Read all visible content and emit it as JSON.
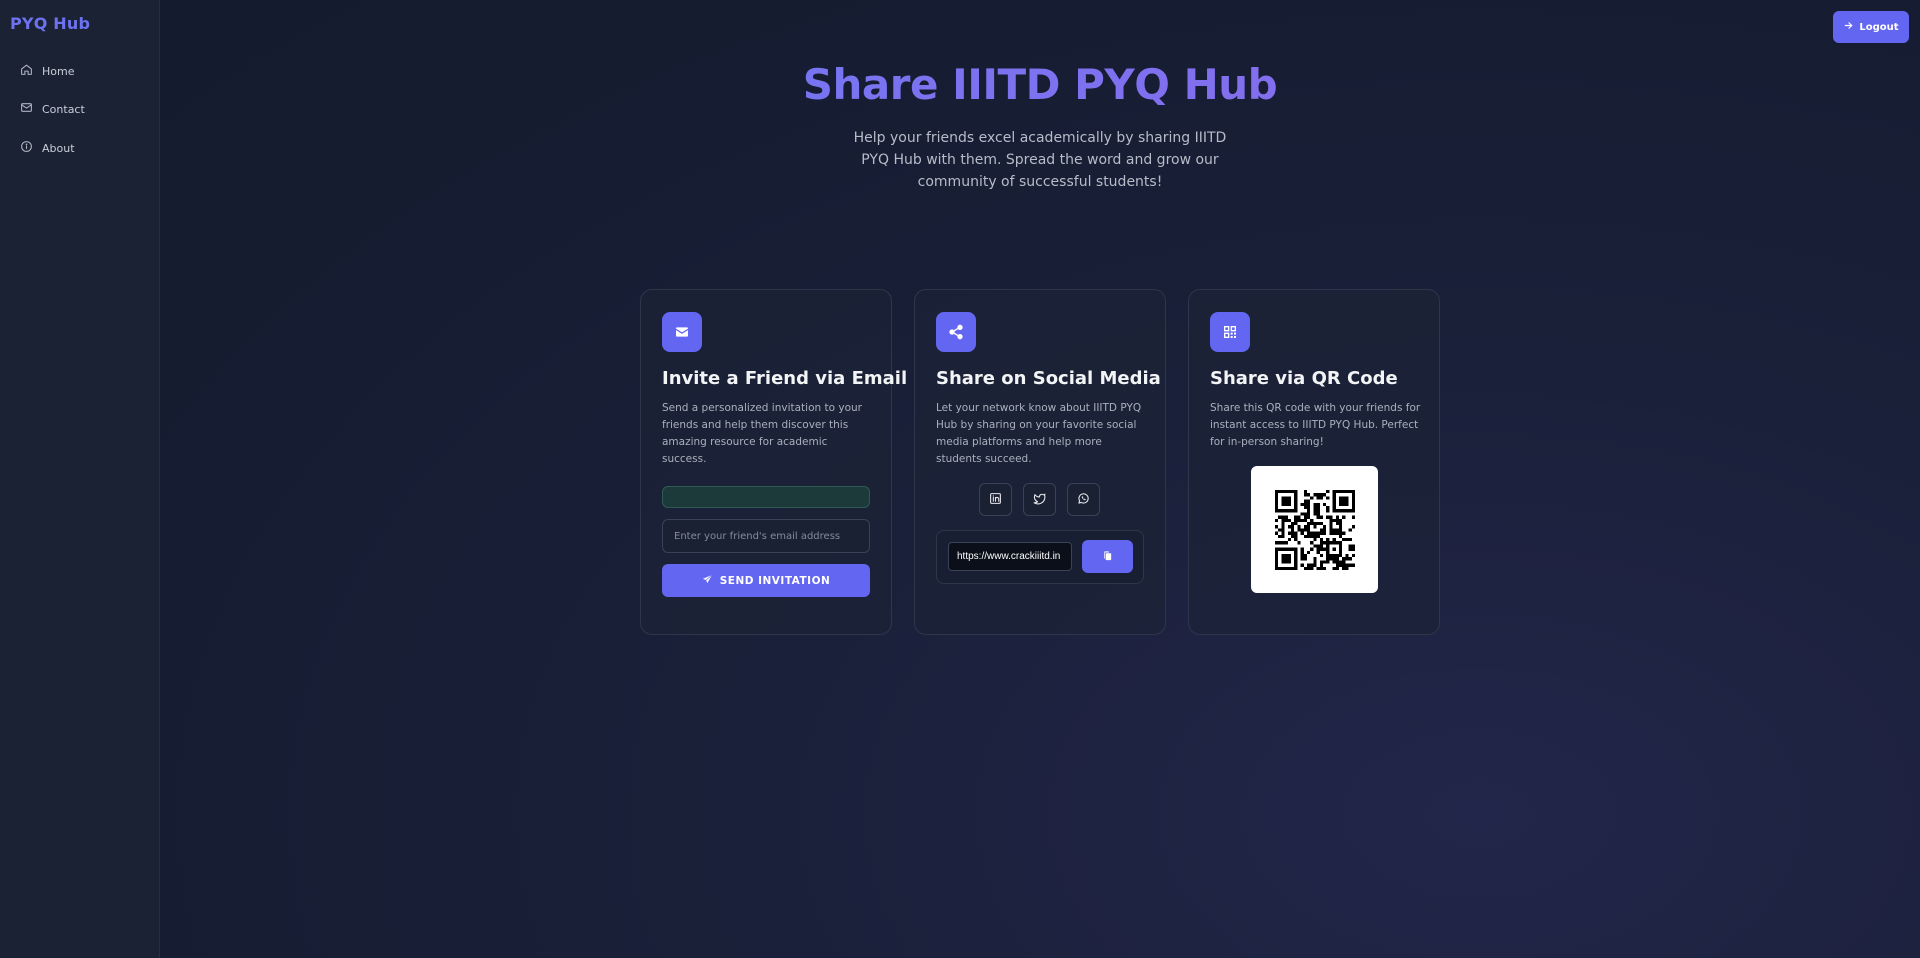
{
  "sidebar": {
    "brand": "PYQ Hub",
    "items": [
      {
        "label": "Home",
        "icon": "home-icon"
      },
      {
        "label": "Contact",
        "icon": "mail-icon"
      },
      {
        "label": "About",
        "icon": "info-icon"
      }
    ]
  },
  "header": {
    "logout_label": "Logout",
    "logout_icon": "arrow-right-icon"
  },
  "hero": {
    "title": "Share IIITD PYQ Hub",
    "subtitle": "Help your friends excel academically by sharing IIITD PYQ Hub with them. Spread the word and grow our community of successful students!"
  },
  "cards": {
    "email": {
      "icon": "envelope-icon",
      "title": "Invite a Friend via Email",
      "description": "Send a personalized invitation to your friends and help them discover this amazing resource for academic success.",
      "input_placeholder": "Enter your friend's email address",
      "input_value": "",
      "button_label": "SEND INVITATION",
      "button_icon": "paper-plane-icon"
    },
    "social": {
      "icon": "share-icon",
      "title": "Share on Social Media",
      "description": "Let your network know about IIITD PYQ Hub by sharing on your favorite social media platforms and help more students succeed.",
      "platforms": [
        "linkedin-icon",
        "twitter-icon",
        "whatsapp-icon"
      ],
      "link_value": "https://www.crackiiitd.in",
      "copy_icon": "copy-icon"
    },
    "qr": {
      "icon": "qr-code-icon",
      "title": "Share via QR Code",
      "description": "Share this QR code with your friends for instant access to IIITD PYQ Hub. Perfect for in-person sharing!"
    }
  },
  "colors": {
    "accent": "#6366f1",
    "brand": "#6d73f0",
    "sidebar_bg": "#1b2234",
    "page_bg": "#161c31"
  }
}
